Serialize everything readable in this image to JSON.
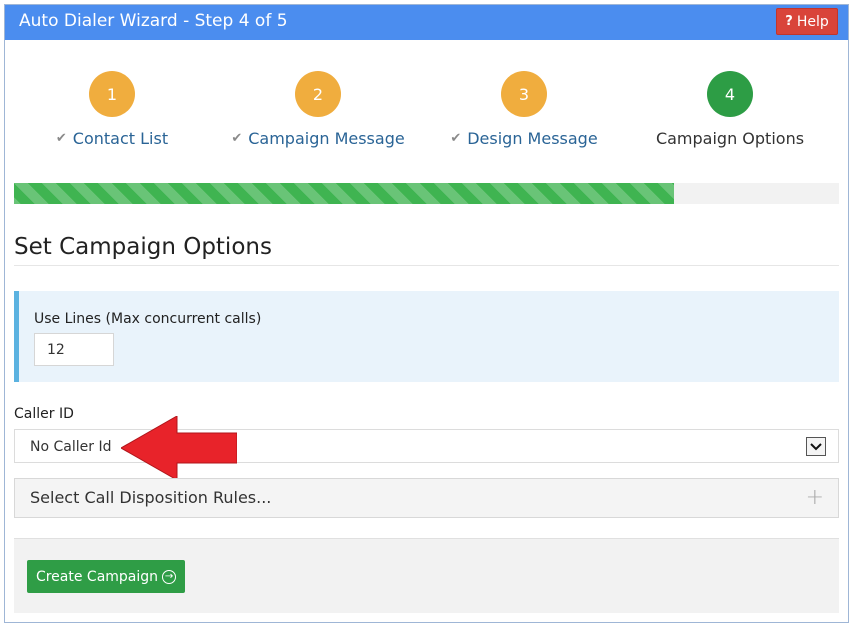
{
  "window": {
    "title": "Auto Dialer Wizard - Step 4 of 5",
    "help_label": "Help",
    "help_icon": "question-icon"
  },
  "steps": [
    {
      "number": "1",
      "label": "Contact List",
      "completed": true
    },
    {
      "number": "2",
      "label": "Campaign Message",
      "completed": true
    },
    {
      "number": "3",
      "label": "Design Message",
      "completed": true
    },
    {
      "number": "4",
      "label": "Campaign Options",
      "completed": false,
      "current": true
    }
  ],
  "progress": {
    "fraction": 0.8
  },
  "section": {
    "title": "Set Campaign Options"
  },
  "use_lines": {
    "label": "Use Lines (Max concurrent calls)",
    "value": "12"
  },
  "caller_id": {
    "label": "Caller ID",
    "selected": "No Caller Id"
  },
  "disposition": {
    "label": "Select Call Disposition Rules...",
    "icon": "plus-icon"
  },
  "actions": {
    "create_label": "Create Campaign",
    "create_icon": "arrow-circle-right-icon"
  },
  "colors": {
    "titlebar": "#4b8def",
    "help": "#d9443a",
    "step_done": "#f0ad3e",
    "step_active": "#2d9d45",
    "progress": "#3fb451",
    "primary_button": "#2f9d46",
    "annotation_arrow": "#e8232a"
  }
}
